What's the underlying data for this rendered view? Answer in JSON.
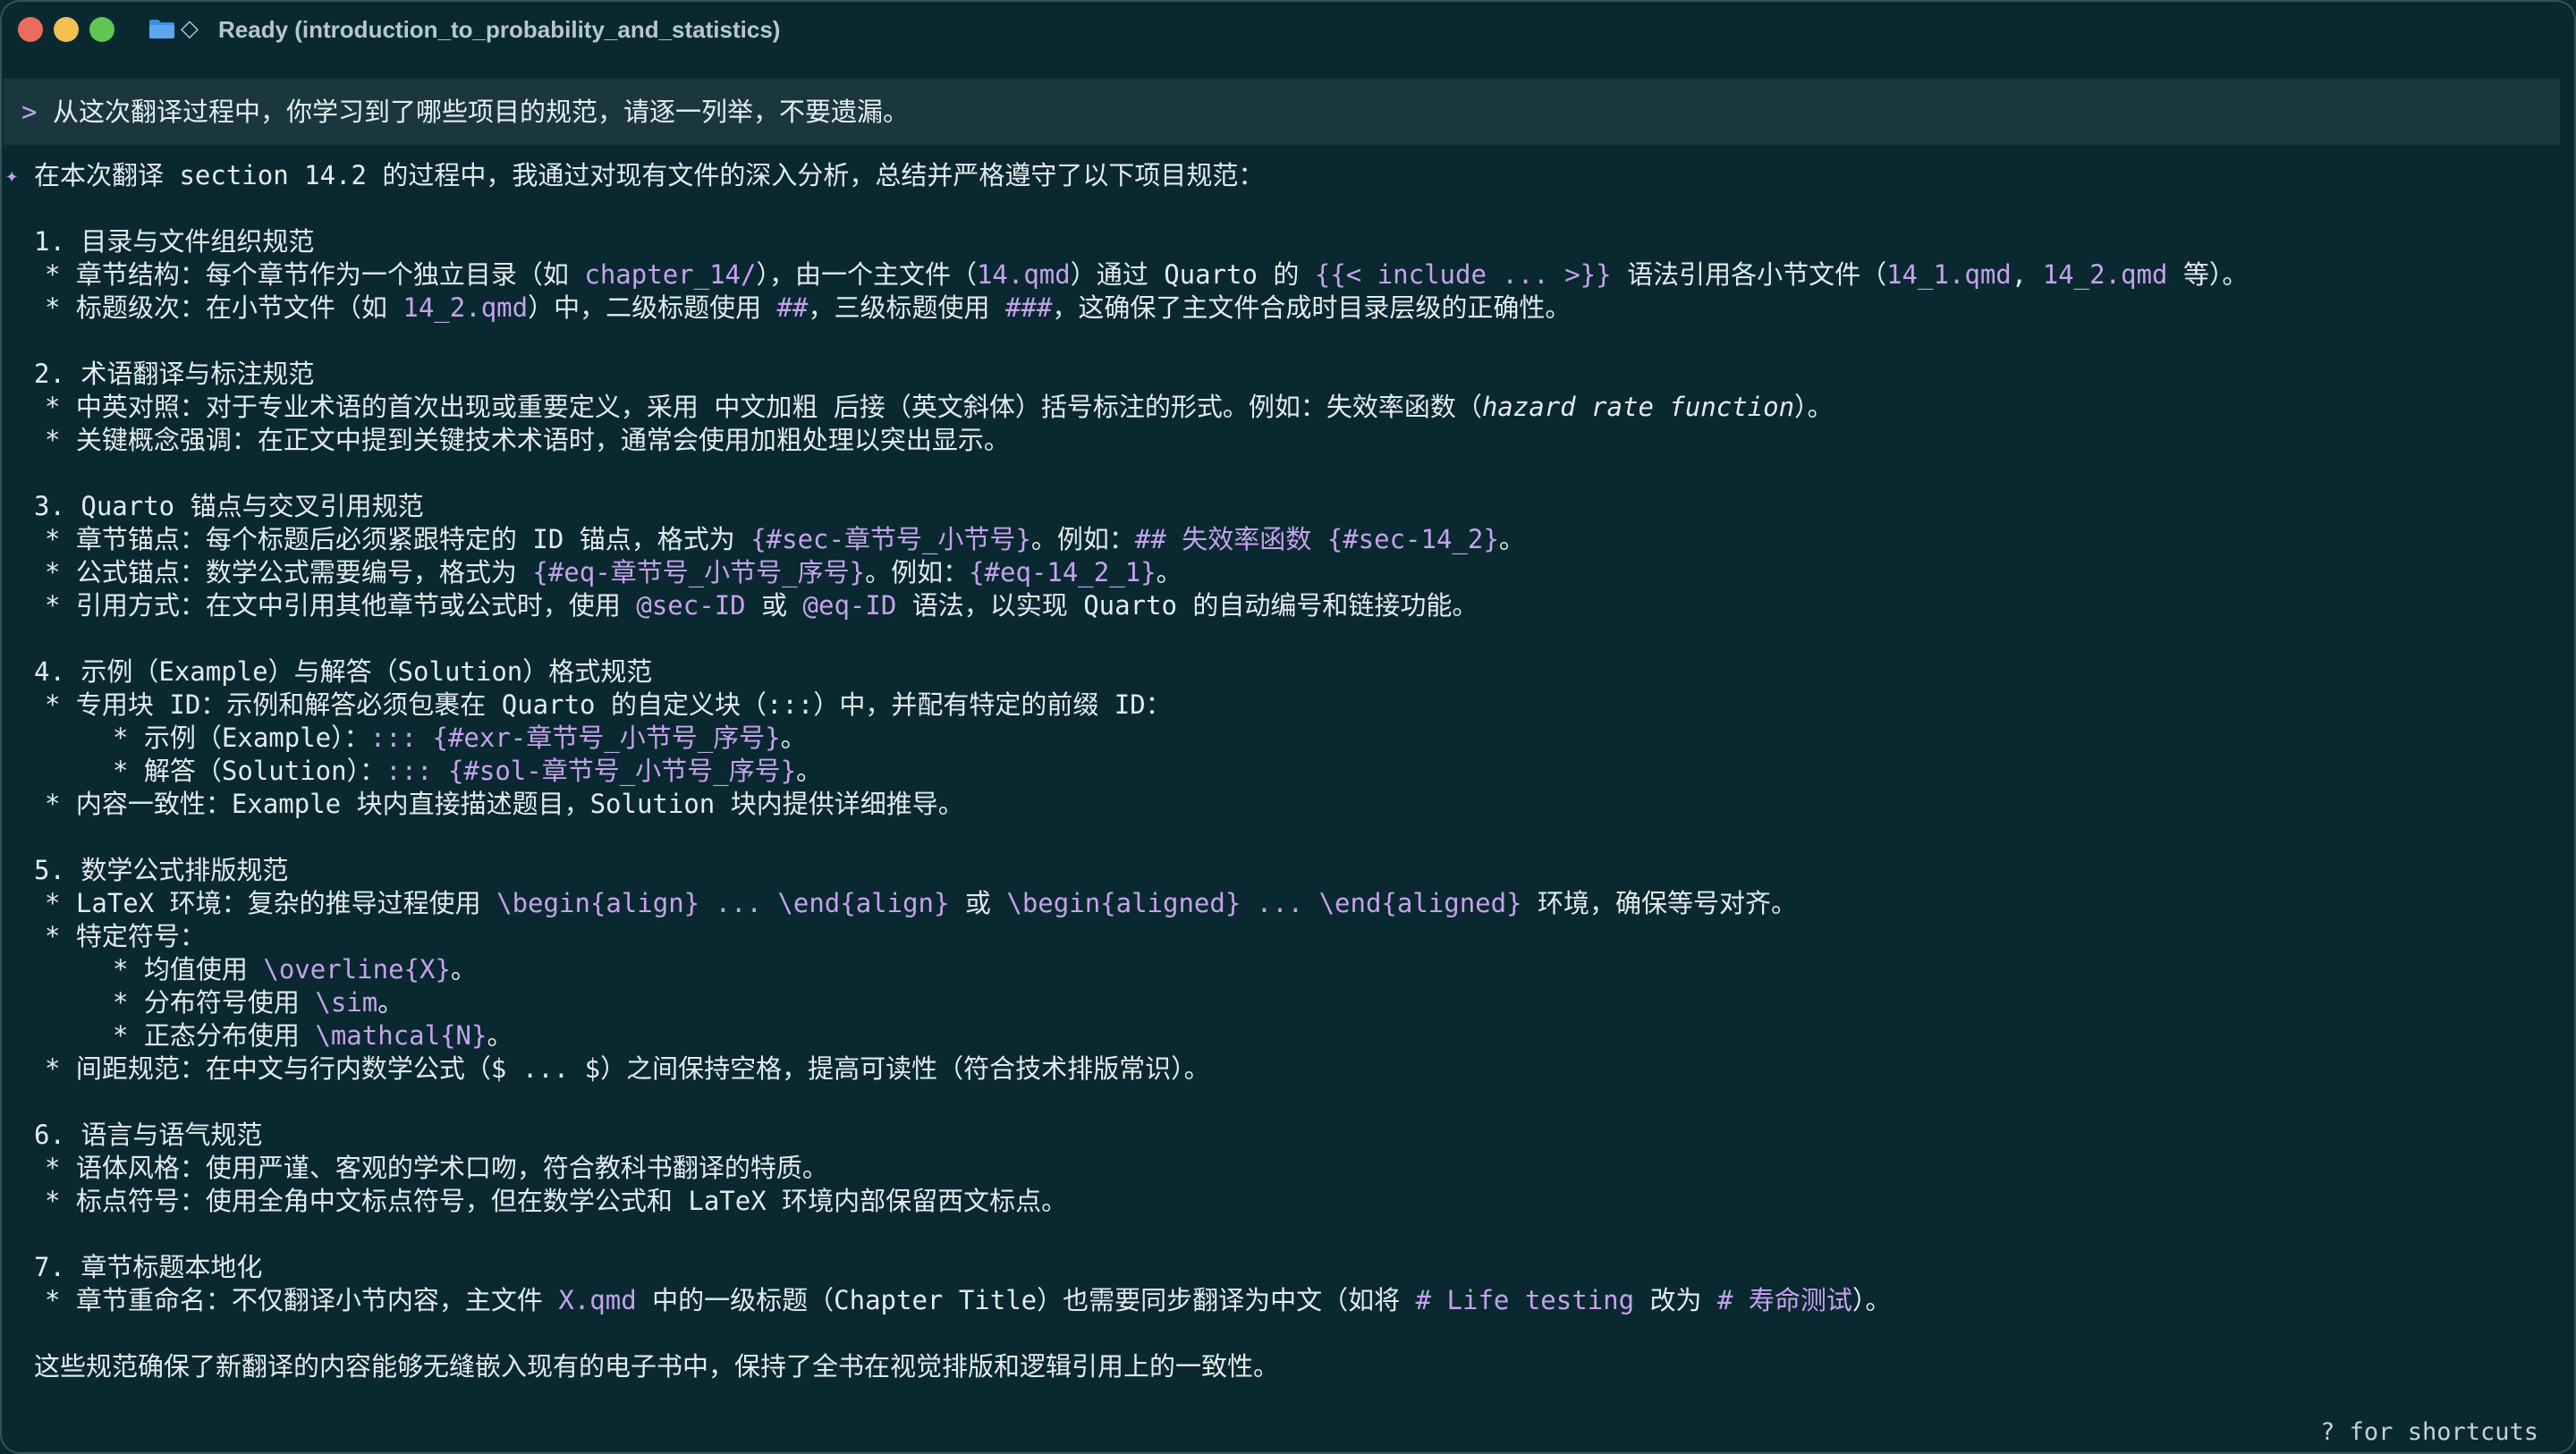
{
  "window": {
    "title": "Ready (introduction_to_probability_and_statistics)",
    "icons": [
      "folder-icon",
      "diamond-icon"
    ],
    "colors": {
      "background": "#0a2830",
      "prompt_bar": "#1a373e",
      "accent": "#c4a2ec",
      "text": "#e3ebed"
    }
  },
  "prompt": {
    "marker": ">",
    "text": "从这次翻译过程中，你学习到了哪些项目的规范，请逐一列举，不要遗漏。"
  },
  "response": {
    "marker": "✦"
  },
  "lines": [
    {
      "indent": 0,
      "segs": [
        [
          "在本次翻译 section 14.2 的过程中，我通过对现有文件的深入分析，总结并严格遵守了以下项目规范：",
          false
        ]
      ]
    },
    null,
    {
      "indent": 0,
      "segs": [
        [
          "1. 目录与文件组织规范",
          false
        ]
      ]
    },
    {
      "indent": 1,
      "segs": [
        [
          "* 章节结构：每个章节作为一个独立目录（如 ",
          false
        ],
        [
          "chapter_14/",
          true
        ],
        [
          "），由一个主文件（",
          false
        ],
        [
          "14.qmd",
          true
        ],
        [
          "）通过 Quarto 的 ",
          false
        ],
        [
          "{{< include ... >}}",
          true
        ],
        [
          " 语法引用各小节文件（",
          false
        ],
        [
          "14_1.qmd",
          true
        ],
        [
          ", ",
          false
        ],
        [
          "14_2.qmd",
          true
        ],
        [
          " 等）。",
          false
        ]
      ]
    },
    {
      "indent": 1,
      "segs": [
        [
          "* 标题级次：在小节文件（如 ",
          false
        ],
        [
          "14_2.qmd",
          true
        ],
        [
          "）中，二级标题使用 ",
          false
        ],
        [
          "##",
          true
        ],
        [
          "，三级标题使用 ",
          false
        ],
        [
          "###",
          true
        ],
        [
          "，这确保了主文件合成时目录层级的正确性。",
          false
        ]
      ]
    },
    null,
    {
      "indent": 0,
      "segs": [
        [
          "2. 术语翻译与标注规范",
          false
        ]
      ]
    },
    {
      "indent": 1,
      "segs": [
        [
          "* 中英对照：对于专业术语的首次出现或重要定义，采用 中文加粗 后接（英文斜体）括号标注的形式。例如：失效率函数（",
          false
        ],
        [
          "hazard rate function",
          false,
          "italic"
        ],
        [
          "）。",
          false
        ]
      ]
    },
    {
      "indent": 1,
      "segs": [
        [
          "* 关键概念强调：在正文中提到关键技术术语时，通常会使用加粗处理以突出显示。",
          false
        ]
      ]
    },
    null,
    {
      "indent": 0,
      "segs": [
        [
          "3. Quarto 锚点与交叉引用规范",
          false
        ]
      ]
    },
    {
      "indent": 1,
      "segs": [
        [
          "* 章节锚点：每个标题后必须紧跟特定的 ID 锚点，格式为 ",
          false
        ],
        [
          "{#sec-章节号_小节号}",
          true
        ],
        [
          "。例如：",
          false
        ],
        [
          "## 失效率函数 {#sec-14_2}",
          true
        ],
        [
          "。",
          false
        ]
      ]
    },
    {
      "indent": 1,
      "segs": [
        [
          "* 公式锚点：数学公式需要编号，格式为 ",
          false
        ],
        [
          "{#eq-章节号_小节号_序号}",
          true
        ],
        [
          "。例如：",
          false
        ],
        [
          "{#eq-14_2_1}",
          true
        ],
        [
          "。",
          false
        ]
      ]
    },
    {
      "indent": 1,
      "segs": [
        [
          "* 引用方式：在文中引用其他章节或公式时，使用 ",
          false
        ],
        [
          "@sec-ID",
          true
        ],
        [
          " 或 ",
          false
        ],
        [
          "@eq-ID",
          true
        ],
        [
          " 语法，以实现 Quarto 的自动编号和链接功能。",
          false
        ]
      ]
    },
    null,
    {
      "indent": 0,
      "segs": [
        [
          "4. 示例（Example）与解答（Solution）格式规范",
          false
        ]
      ]
    },
    {
      "indent": 1,
      "segs": [
        [
          "* 专用块 ID：示例和解答必须包裹在 Quarto 的自定义块（:::）中，并配有特定的前缀 ID：",
          false
        ]
      ]
    },
    {
      "indent": 2,
      "segs": [
        [
          "* 示例（Example）：",
          false
        ],
        [
          "::: {#exr-章节号_小节号_序号}",
          true
        ],
        [
          "。",
          false
        ]
      ]
    },
    {
      "indent": 2,
      "segs": [
        [
          "* 解答（Solution）：",
          false
        ],
        [
          "::: {#sol-章节号_小节号_序号}",
          true
        ],
        [
          "。",
          false
        ]
      ]
    },
    {
      "indent": 1,
      "segs": [
        [
          "* 内容一致性：Example 块内直接描述题目，Solution 块内提供详细推导。",
          false
        ]
      ]
    },
    null,
    {
      "indent": 0,
      "segs": [
        [
          "5. 数学公式排版规范",
          false
        ]
      ]
    },
    {
      "indent": 1,
      "segs": [
        [
          "* LaTeX 环境：复杂的推导过程使用 ",
          false
        ],
        [
          "\\begin{align} ... \\end{align}",
          true
        ],
        [
          " 或 ",
          false
        ],
        [
          "\\begin{aligned} ... \\end{aligned}",
          true
        ],
        [
          " 环境，确保等号对齐。",
          false
        ]
      ]
    },
    {
      "indent": 1,
      "segs": [
        [
          "* 特定符号：",
          false
        ]
      ]
    },
    {
      "indent": 2,
      "segs": [
        [
          "* 均值使用 ",
          false
        ],
        [
          "\\overline{X}",
          true
        ],
        [
          "。",
          false
        ]
      ]
    },
    {
      "indent": 2,
      "segs": [
        [
          "* 分布符号使用 ",
          false
        ],
        [
          "\\sim",
          true
        ],
        [
          "。",
          false
        ]
      ]
    },
    {
      "indent": 2,
      "segs": [
        [
          "* 正态分布使用 ",
          false
        ],
        [
          "\\mathcal{N}",
          true
        ],
        [
          "。",
          false
        ]
      ]
    },
    {
      "indent": 1,
      "segs": [
        [
          "* 间距规范：在中文与行内数学公式（$ ... $）之间保持空格，提高可读性（符合技术排版常识）。",
          false
        ]
      ]
    },
    null,
    {
      "indent": 0,
      "segs": [
        [
          "6. 语言与语气规范",
          false
        ]
      ]
    },
    {
      "indent": 1,
      "segs": [
        [
          "* 语体风格：使用严谨、客观的学术口吻，符合教科书翻译的特质。",
          false
        ]
      ]
    },
    {
      "indent": 1,
      "segs": [
        [
          "* 标点符号：使用全角中文标点符号，但在数学公式和 LaTeX 环境内部保留西文标点。",
          false
        ]
      ]
    },
    null,
    {
      "indent": 0,
      "segs": [
        [
          "7. 章节标题本地化",
          false
        ]
      ]
    },
    {
      "indent": 1,
      "segs": [
        [
          "* 章节重命名：不仅翻译小节内容，主文件 ",
          false
        ],
        [
          "X.qmd",
          true
        ],
        [
          " 中的一级标题（Chapter Title）也需要同步翻译为中文（如将 ",
          false
        ],
        [
          "# Life testing",
          true
        ],
        [
          " 改为 ",
          false
        ],
        [
          "# 寿命测试",
          true
        ],
        [
          "）。",
          false
        ]
      ]
    },
    null,
    {
      "indent": 0,
      "segs": [
        [
          "这些规范确保了新翻译的内容能够无缝嵌入现有的电子书中，保持了全书在视觉排版和逻辑引用上的一致性。",
          false
        ]
      ]
    }
  ],
  "footer": {
    "shortcuts": "? for shortcuts"
  }
}
